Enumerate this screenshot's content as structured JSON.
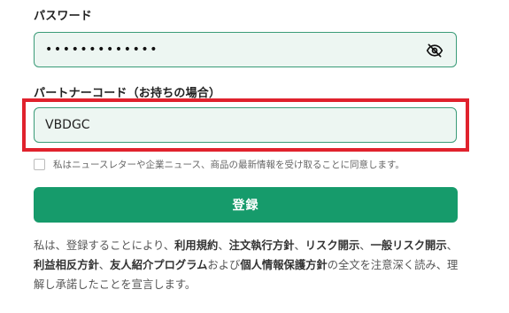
{
  "form": {
    "password_label": "パスワード",
    "password_mask": "•••••••••••••",
    "partner_code_label": "パートナーコード（お持ちの場合）",
    "partner_code_value": "VBDGC",
    "consent_text": "私はニュースレターや企業ニュース、商品の最新情報を受け取ることに同意します。",
    "submit_label": "登録"
  },
  "terms": {
    "p1": "私は、登録することにより、",
    "l1": "利用規約",
    "s1": "、",
    "l2": "注文執行方針",
    "s2": "、",
    "l3": "リスク開示",
    "s3": "、",
    "l4": "一般リスク開示",
    "s4": "、",
    "l5": "利益相反方針",
    "s5": "、",
    "l6": "友人紹介プログラム",
    "s6": "および",
    "l7": "個人情報保護方針",
    "p2": "の全文を注意深く読み、理解し承諾したことを宣言します。"
  },
  "icons": {
    "password_toggle": "eye-off-icon"
  },
  "colors": {
    "accent": "#169b6b",
    "field_border": "#3a9b78",
    "field_bg": "#edf6f2",
    "highlight": "#e0222d"
  }
}
